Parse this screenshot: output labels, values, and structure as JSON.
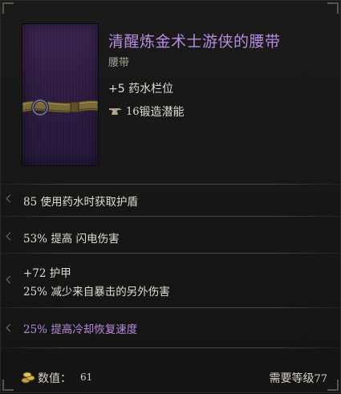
{
  "item": {
    "name": "清醒炼金术士游侠的腰带",
    "type": "腰带",
    "base_stat": "+5 药水栏位",
    "forge_potential_value": "16",
    "forge_potential_label": "锻造潜能"
  },
  "affixes": [
    {
      "value": "85",
      "text": "使用药水时获取护盾"
    },
    {
      "value": "53%",
      "text": "提高 闪电伤害"
    },
    {
      "value": "+72",
      "text": "护甲"
    },
    {
      "value": "25%",
      "text": "减少来自暴击的另外伤害"
    },
    {
      "value": "25%",
      "text": "提高冷却恢复速度"
    }
  ],
  "footer": {
    "value_label": "数值：",
    "value": "61",
    "requirement_label": "需要等级",
    "requirement_level": "77"
  },
  "colors": {
    "title": "#b98be0",
    "text": "#e0dbd0",
    "divider": "#4a4a4a",
    "icon_bg": "#2c1b3f"
  }
}
